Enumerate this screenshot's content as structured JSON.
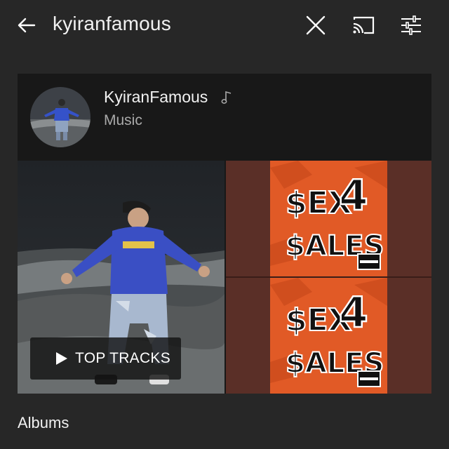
{
  "search": {
    "query": "kyiranfamous"
  },
  "icons": {
    "back": "arrow-left-icon",
    "clear": "close-icon",
    "cast": "cast-icon",
    "filter": "tune-icon"
  },
  "artist": {
    "name": "KyiranFamous",
    "type": "Music",
    "badge_icon": "music-note-icon"
  },
  "shelf": {
    "top_tracks_label": "TOP TRACKS",
    "album_art_text": [
      "$EX",
      "4",
      "$ALES"
    ]
  },
  "section": {
    "albums_title": "Albums"
  },
  "colors": {
    "background": "#272727",
    "card": "#181818",
    "secondary_text": "#aaaaaa",
    "album_orange": "#e15a26",
    "album_maroon": "#5a2f27"
  }
}
